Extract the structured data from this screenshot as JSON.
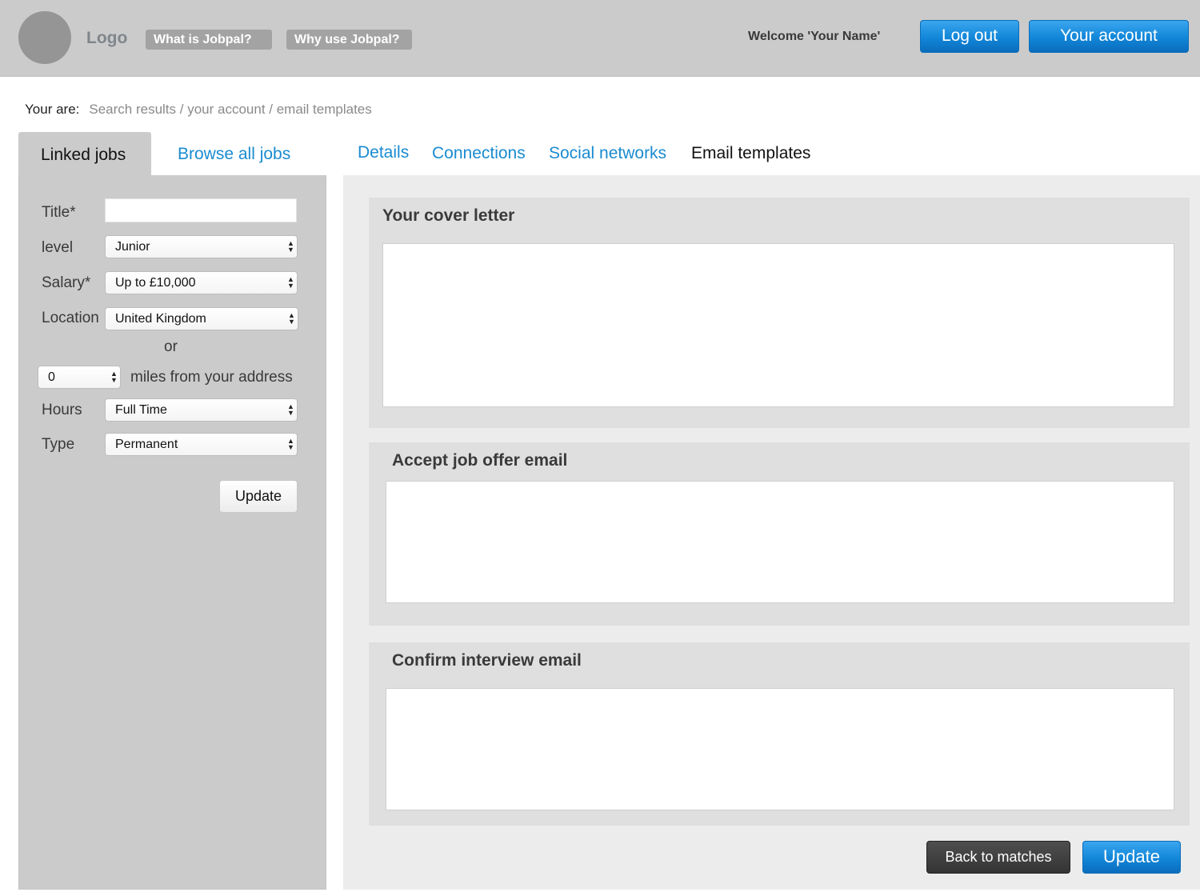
{
  "header": {
    "logo_text": "Logo",
    "nav": [
      "What is Jobpal?",
      "Why use Jobpal?"
    ],
    "welcome": "Welcome 'Your Name'",
    "logout_label": "Log out",
    "account_label": "Your account"
  },
  "breadcrumb": {
    "label": "Your are:",
    "path": "Search results / your account / email templates"
  },
  "left_tabs": {
    "linked": "Linked jobs",
    "browse": "Browse all jobs"
  },
  "filters": {
    "title_label": "Title*",
    "title_value": "",
    "level_label": "level",
    "level_value": "Junior",
    "salary_label": "Salary*",
    "salary_value": "Up to £10,000",
    "location_label": "Location",
    "location_value": "United Kingdom",
    "or_text": "or",
    "miles_value": "0",
    "miles_label": "miles from your address",
    "hours_label": "Hours",
    "hours_value": "Full Time",
    "type_label": "Type",
    "type_value": "Permanent",
    "update_label": "Update"
  },
  "account_tabs": [
    {
      "label": "Details",
      "active": false
    },
    {
      "label": "Connections",
      "active": false
    },
    {
      "label": "Social networks",
      "active": false
    },
    {
      "label": "Email templates",
      "active": true
    }
  ],
  "templates": [
    {
      "title": "Your cover letter",
      "value": ""
    },
    {
      "title": "Accept job offer email",
      "value": ""
    },
    {
      "title": "Confirm interview email",
      "value": ""
    }
  ],
  "actions": {
    "back_label": "Back to matches",
    "update_label": "Update"
  },
  "colors": {
    "accent_blue": "#1a8bd0",
    "header_bg": "#cbcbcb"
  }
}
